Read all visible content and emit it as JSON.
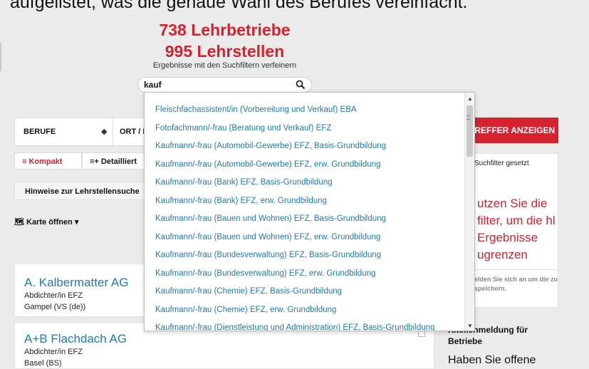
{
  "caption": "aufgelistet, was die genaue Wahl des Berufes vereinfacht.",
  "header": {
    "count_companies": "738 Lehrbetriebe",
    "count_positions": "995 Lehrstellen",
    "refine": "Ergebnisse mit den Suchfiltern verfeinern"
  },
  "search": {
    "value": "kauf",
    "icon": "search-icon"
  },
  "filters": {
    "berufe": "BERUFE",
    "ort": "ORT / P"
  },
  "view": {
    "kompakt": "≡ Kompakt",
    "detailliert": "≡+ Detailliert"
  },
  "hinweise": "Hinweise zur Lehrstellensuche",
  "karte": "🗺 Karte öffnen ▾",
  "dropdown": {
    "items": [
      "Fleischfachassistent/in (Vorbereitung und Verkauf) EBA",
      "Fotofachmann/-frau (Beratung und Verkauf) EFZ",
      "Kaufmann/-frau (Automobil-Gewerbe) EFZ, Basis-Grundbildung",
      "Kaufmann/-frau (Automobil-Gewerbe) EFZ, erw. Grundbildung",
      "Kaufmann/-frau (Bank) EFZ, Basis-Grundbildung",
      "Kaufmann/-frau (Bank) EFZ, erw. Grundbildung",
      "Kaufmann/-frau (Bauen und Wohnen) EFZ, Basis-Grundbildung",
      "Kaufmann/-frau (Bauen und Wohnen) EFZ, erw. Grundbildung",
      "Kaufmann/-frau (Bundesverwaltung) EFZ, Basis-Grundbildung",
      "Kaufmann/-frau (Bundesverwaltung) EFZ, erw. Grundbildung",
      "Kaufmann/-frau (Chemie) EFZ, Basis-Grundbildung",
      "Kaufmann/-frau (Chemie) EFZ, erw. Grundbildung",
      "Kaufmann/-frau (Dienstleistung und Administration) EFZ, Basis-Grundbildung"
    ]
  },
  "results": [
    {
      "name": "A. Kalbermatter AG",
      "beruf": "Abdichter/in EFZ",
      "ort": "Gampel (VS (de))"
    },
    {
      "name": "A+B Flachdach AG",
      "beruf": "Abdichter/in EFZ",
      "ort": "Basel (BS)"
    }
  ],
  "right": {
    "cta": "TREFFER ANZEIGEN",
    "filter_note": "Suchfilter gesetzt",
    "big_text": "utzen Sie die filter, um die hl Ergebnisse ugrenzen",
    "small_text": "elden Sie sich an um die zu speichern.",
    "section_title": "rstellenmeldung für Betriebe",
    "section_big": "Haben Sie offene"
  },
  "colors": {
    "accent": "#d6212f",
    "link": "#1f7ab5"
  }
}
